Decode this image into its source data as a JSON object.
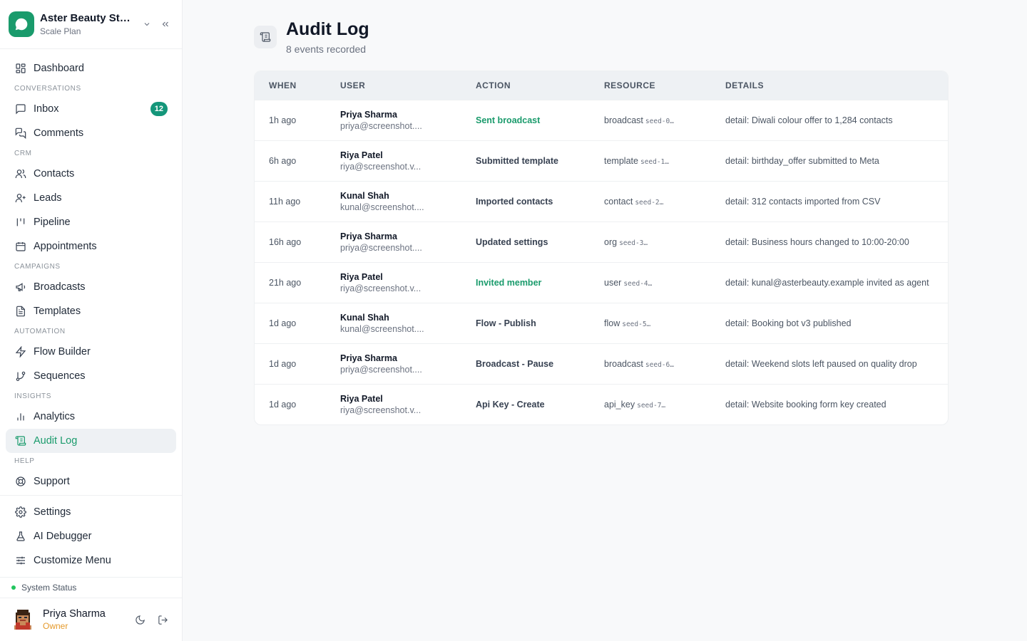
{
  "org": {
    "name": "Aster Beauty Stu...",
    "plan": "Scale Plan"
  },
  "nav": {
    "dashboard": "Dashboard",
    "sec_conversations": "CONVERSATIONS",
    "inbox": "Inbox",
    "inbox_badge": "12",
    "comments": "Comments",
    "sec_crm": "CRM",
    "contacts": "Contacts",
    "leads": "Leads",
    "pipeline": "Pipeline",
    "appointments": "Appointments",
    "sec_campaigns": "CAMPAIGNS",
    "broadcasts": "Broadcasts",
    "templates": "Templates",
    "sec_automation": "AUTOMATION",
    "flow_builder": "Flow Builder",
    "sequences": "Sequences",
    "sec_insights": "INSIGHTS",
    "analytics": "Analytics",
    "audit_log": "Audit Log",
    "sec_help": "HELP",
    "support": "Support",
    "settings": "Settings",
    "ai_debugger": "AI Debugger",
    "customize_menu": "Customize Menu"
  },
  "status": {
    "label": "System Status",
    "color": "#22c55e"
  },
  "user": {
    "name": "Priya Sharma",
    "role": "Owner"
  },
  "page": {
    "title": "Audit Log",
    "subtitle": "8 events recorded"
  },
  "table": {
    "headers": [
      "WHEN",
      "USER",
      "ACTION",
      "RESOURCE",
      "DETAILS"
    ],
    "rows": [
      {
        "when": "1h ago",
        "user_name": "Priya Sharma",
        "user_email": "priya@screenshot....",
        "action": "Sent broadcast",
        "action_accent": true,
        "res_type": "broadcast",
        "res_id": "seed-0…",
        "details": "detail: Diwali colour offer to 1,284 contacts"
      },
      {
        "when": "6h ago",
        "user_name": "Riya Patel",
        "user_email": "riya@screenshot.v...",
        "action": "Submitted template",
        "action_accent": false,
        "res_type": "template",
        "res_id": "seed-1…",
        "details": "detail: birthday_offer submitted to Meta"
      },
      {
        "when": "11h ago",
        "user_name": "Kunal Shah",
        "user_email": "kunal@screenshot....",
        "action": "Imported contacts",
        "action_accent": false,
        "res_type": "contact",
        "res_id": "seed-2…",
        "details": "detail: 312 contacts imported from CSV"
      },
      {
        "when": "16h ago",
        "user_name": "Priya Sharma",
        "user_email": "priya@screenshot....",
        "action": "Updated settings",
        "action_accent": false,
        "res_type": "org",
        "res_id": "seed-3…",
        "details": "detail: Business hours changed to 10:00-20:00"
      },
      {
        "when": "21h ago",
        "user_name": "Riya Patel",
        "user_email": "riya@screenshot.v...",
        "action": "Invited member",
        "action_accent": true,
        "res_type": "user",
        "res_id": "seed-4…",
        "details": "detail: kunal@asterbeauty.example invited as agent"
      },
      {
        "when": "1d ago",
        "user_name": "Kunal Shah",
        "user_email": "kunal@screenshot....",
        "action": "Flow - Publish",
        "action_accent": false,
        "res_type": "flow",
        "res_id": "seed-5…",
        "details": "detail: Booking bot v3 published"
      },
      {
        "when": "1d ago",
        "user_name": "Priya Sharma",
        "user_email": "priya@screenshot....",
        "action": "Broadcast - Pause",
        "action_accent": false,
        "res_type": "broadcast",
        "res_id": "seed-6…",
        "details": "detail: Weekend slots left paused on quality drop"
      },
      {
        "when": "1d ago",
        "user_name": "Riya Patel",
        "user_email": "riya@screenshot.v...",
        "action": "Api Key - Create",
        "action_accent": false,
        "res_type": "api_key",
        "res_id": "seed-7…",
        "details": "detail: Website booking form key created"
      }
    ]
  },
  "colors": {
    "accent": "#1a9b6c",
    "badge": "#14967a",
    "role": "#e59a2c"
  }
}
